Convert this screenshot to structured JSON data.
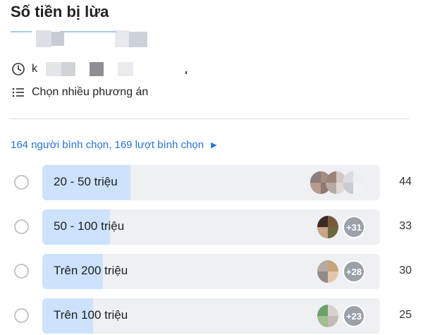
{
  "poll": {
    "title": "Số tiền bị lừa",
    "multi_choice_label": "Chọn nhiều phương án",
    "deadline_text": "k",
    "summary": "164 người bình chọn, 169 lượt bình chọn",
    "options": [
      {
        "label": "20 - 50 triệu",
        "count": "44",
        "more": "",
        "fill_percent": 26
      },
      {
        "label": "50 - 100 triệu",
        "count": "33",
        "more": "+31",
        "fill_percent": 20
      },
      {
        "label": "Trên 200 triệu",
        "count": "30",
        "more": "+28",
        "fill_percent": 18
      },
      {
        "label": "Trên 100 triệu",
        "count": "25",
        "more": "+23",
        "fill_percent": 15
      }
    ]
  },
  "icons": {
    "deadline": "clock-icon",
    "multi": "list-icon",
    "summary": "caret-right-icon"
  },
  "colors": {
    "accent": "#2a72d6",
    "fill": "#cde2fd",
    "bar": "#eef0f3"
  }
}
